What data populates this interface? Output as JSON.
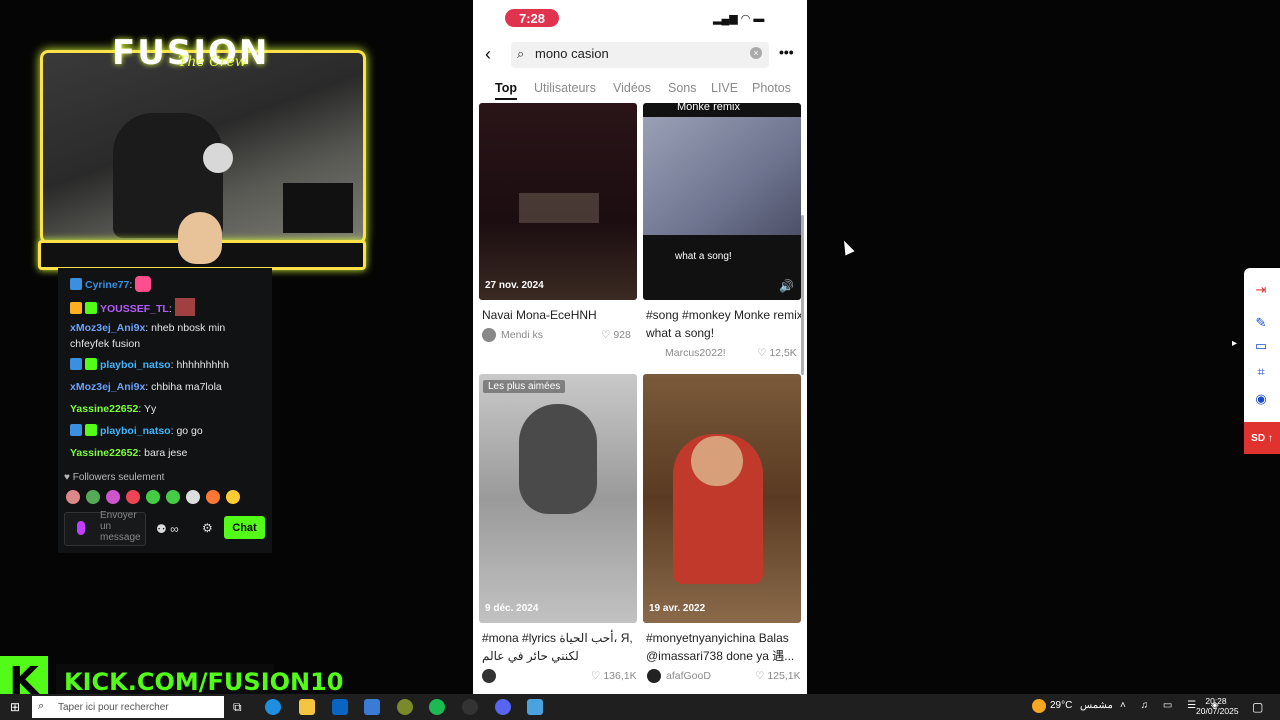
{
  "stream": {
    "cam_title": "FUSION",
    "cam_sub": "The Crew",
    "kick_url": "KICK.COM/FUSION10",
    "kick_k": "K"
  },
  "chat": {
    "messages": [
      {
        "user": "Cyrine77",
        "text": "",
        "color": "#3a8fe0"
      },
      {
        "user": "YOUSSEF_TL",
        "text": "",
        "color": "#b65cff"
      },
      {
        "user": "xMoz3ej_Ani9x",
        "text": "nheb nbosk min chfeyfek fusion",
        "color": "#6aa2ff"
      },
      {
        "user": "playboi_natso",
        "text": "hhhhhhhhh",
        "color": "#3fb6ff"
      },
      {
        "user": "xMoz3ej_Ani9x",
        "text": "chbiha ma7lola",
        "color": "#6aa2ff"
      },
      {
        "user": "Yassine22652",
        "text": "Yy",
        "color": "#7dff3a"
      },
      {
        "user": "playboi_natso",
        "text": "go go",
        "color": "#3fb6ff"
      },
      {
        "user": "Yassine22652",
        "text": "bara jese",
        "color": "#7dff3a"
      }
    ],
    "followers_label": "Followers seulement",
    "input_placeholder": "Envoyer un message",
    "send_label": "Chat"
  },
  "phone": {
    "clock": "7:28",
    "search_query": "mono casion",
    "tabs": [
      "Top",
      "Utilisateurs",
      "Vidéos",
      "Sons",
      "LIVE",
      "Photos"
    ],
    "active_tab": "Top",
    "videos": [
      {
        "date": "27 nov. 2024",
        "caption": "Navai Mona-EceHNH",
        "author": "Mendi ks",
        "likes": "928",
        "overlay": ""
      },
      {
        "date": "",
        "caption": "#song #monkey Monke remix what a song!",
        "author": "Marcus2022!",
        "likes": "12,5K",
        "overlay": "Monke remix",
        "overlay2": "what a song!"
      },
      {
        "date": "9 déc. 2024",
        "caption": "#mona #lyrics أحب الحياة، Я, لكنني حائر في عالم مضطرب...",
        "author": "",
        "likes": "136,1K",
        "overlay": "Les plus aimées"
      },
      {
        "date": "19 avr. 2022",
        "caption": "#monyetnyanyichina Balas @imassari738 done ya 遇...",
        "author": "afafGooD",
        "likes": "125,1K",
        "overlay": ""
      }
    ]
  },
  "sidebar": {
    "sd_label": "SD"
  },
  "taskbar": {
    "search_placeholder": "Taper ici pour rechercher",
    "weather_temp": "29°C",
    "weather_text": "مشمس",
    "time": "20:28",
    "date": "20/07/2025"
  }
}
